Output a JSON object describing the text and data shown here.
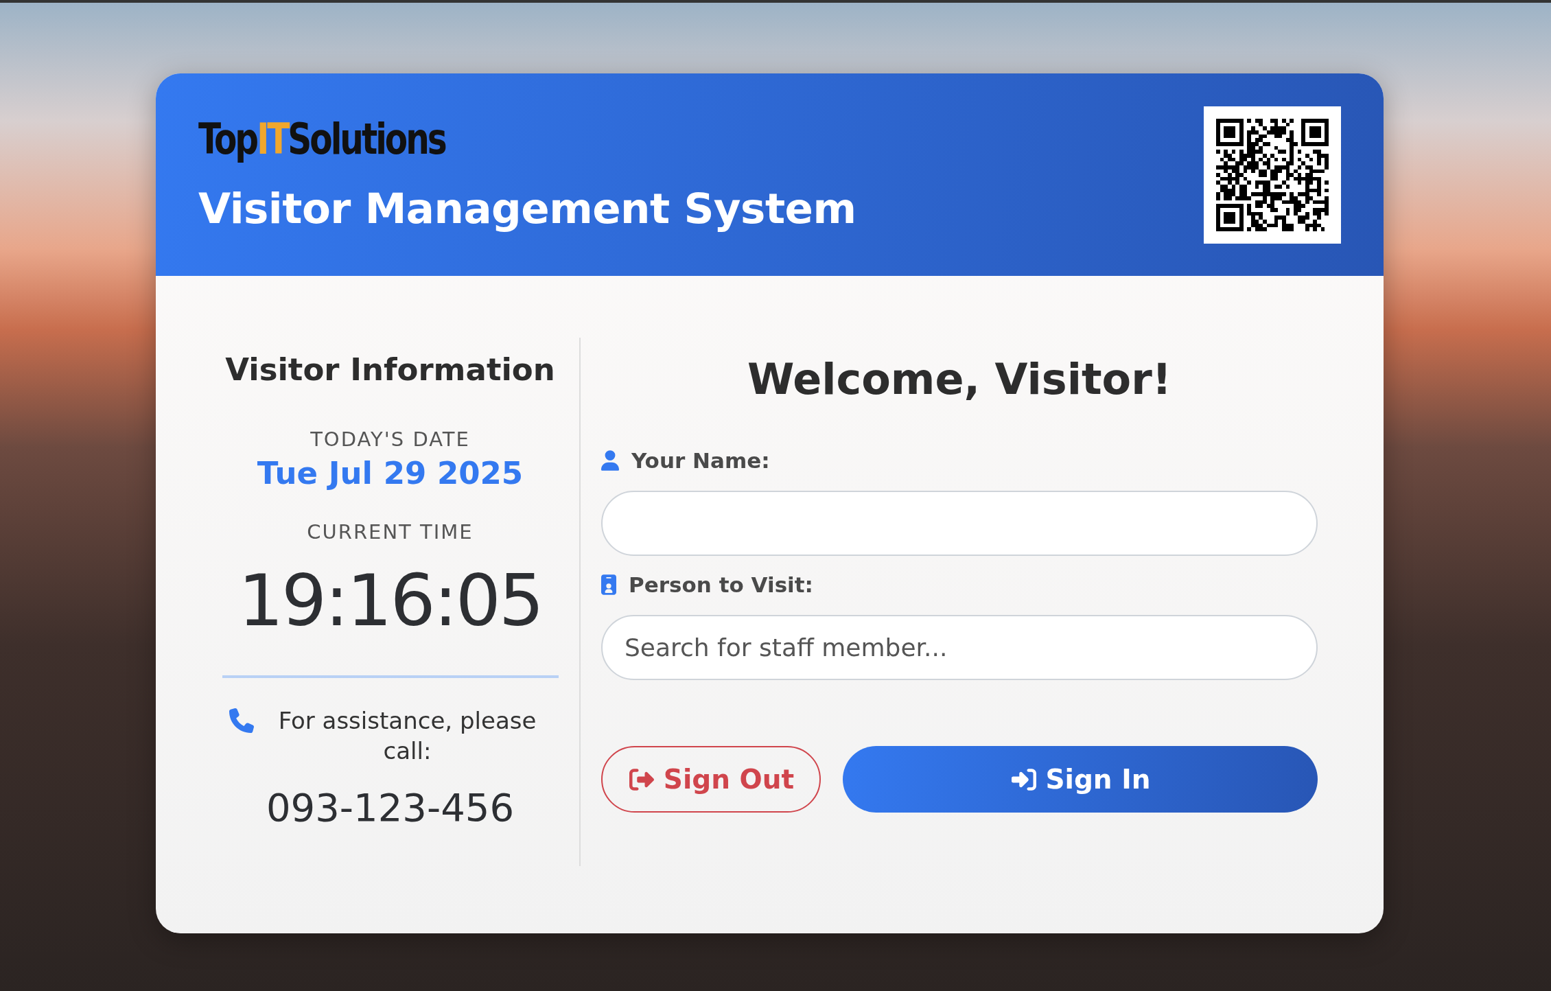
{
  "header": {
    "logo": [
      {
        "text": "Top",
        "highlight": false
      },
      {
        "text": "IT",
        "highlight": true
      },
      {
        "text": "Solutions",
        "highlight": false
      }
    ],
    "title": "Visitor Management System"
  },
  "info": {
    "heading": "Visitor Information",
    "date_label": "TODAY'S DATE",
    "date": "Tue Jul 29 2025",
    "time_label": "CURRENT TIME",
    "time": "19:16:05",
    "assistance": "For assistance, please call:",
    "phone": "093-123-456"
  },
  "form": {
    "heading": "Welcome, Visitor!",
    "fields": [
      {
        "kind": "person",
        "label": "Your Name:"
      },
      {
        "kind": "badge",
        "label": "Person to Visit:",
        "placeholder": "Search for staff member..."
      }
    ],
    "buttons": [
      {
        "kind": "outline",
        "label": "Sign Out"
      },
      {
        "kind": "primary",
        "label": "Sign In"
      }
    ]
  }
}
